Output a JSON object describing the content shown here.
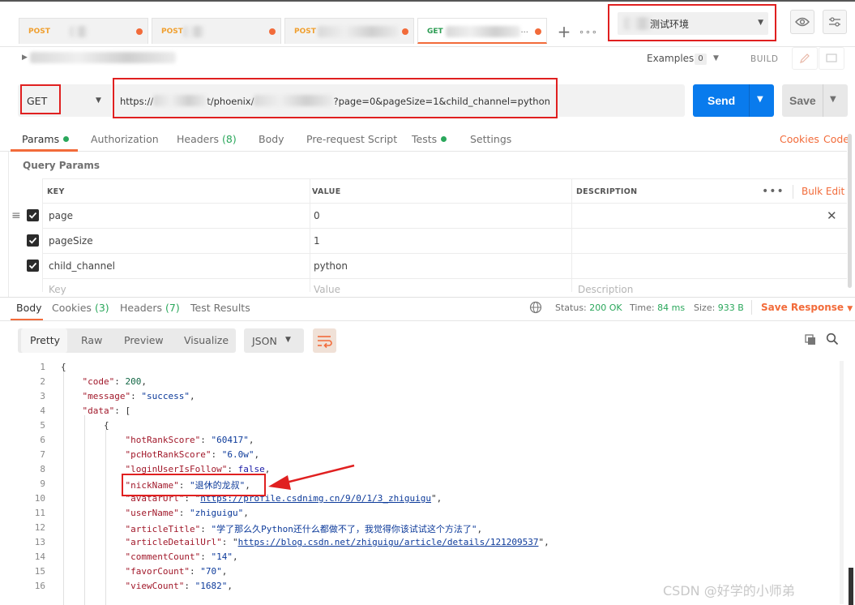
{
  "tabs": [
    {
      "method": "POST",
      "modified": true
    },
    {
      "method": "POST",
      "modified": true
    },
    {
      "method": "POST",
      "modified": true
    },
    {
      "method": "GET",
      "suffix": "...",
      "modified": true,
      "active": true
    }
  ],
  "environment": {
    "name": "测试环境"
  },
  "request": {
    "examples_label": "Examples",
    "examples_count": "0",
    "build_label": "BUILD",
    "method": "GET",
    "url_part1": "https://",
    "url_part2": "t/phoenix/",
    "url_part3": "?page=0&pageSize=1&child_channel=python",
    "send_label": "Send",
    "save_label": "Save"
  },
  "request_tabs": {
    "params": "Params",
    "authorization": "Authorization",
    "headers": "Headers",
    "headers_count": "(8)",
    "body": "Body",
    "prerequest": "Pre-request Script",
    "tests": "Tests",
    "settings": "Settings",
    "cookies": "Cookies",
    "code": "Code"
  },
  "query_params": {
    "title": "Query Params",
    "headers": {
      "key": "KEY",
      "value": "VALUE",
      "description": "DESCRIPTION"
    },
    "bulk_edit": "Bulk Edit",
    "rows": [
      {
        "key": "page",
        "value": "0",
        "checked": true
      },
      {
        "key": "pageSize",
        "value": "1",
        "checked": true
      },
      {
        "key": "child_channel",
        "value": "python",
        "checked": true
      }
    ],
    "placeholder": {
      "key": "Key",
      "value": "Value",
      "description": "Description"
    }
  },
  "response": {
    "tabs": {
      "body": "Body",
      "cookies": "Cookies",
      "cookies_count": "(3)",
      "headers": "Headers",
      "headers_count": "(7)",
      "test_results": "Test Results"
    },
    "status_label": "Status:",
    "status_value": "200 OK",
    "time_label": "Time:",
    "time_value": "84 ms",
    "size_label": "Size:",
    "size_value": "933 B",
    "save_response": "Save Response",
    "views": [
      "Pretty",
      "Raw",
      "Preview",
      "Visualize"
    ],
    "active_view": "Pretty",
    "format": "JSON"
  },
  "code_lines": [
    {
      "n": "1",
      "indent": 0,
      "parts": [
        [
          "p",
          "{"
        ]
      ]
    },
    {
      "n": "2",
      "indent": 1,
      "parts": [
        [
          "k",
          "\"code\""
        ],
        [
          "p",
          ": "
        ],
        [
          "n",
          "200"
        ],
        [
          "p",
          ","
        ]
      ]
    },
    {
      "n": "3",
      "indent": 1,
      "parts": [
        [
          "k",
          "\"message\""
        ],
        [
          "p",
          ": "
        ],
        [
          "s",
          "\"success\""
        ],
        [
          "p",
          ","
        ]
      ]
    },
    {
      "n": "4",
      "indent": 1,
      "parts": [
        [
          "k",
          "\"data\""
        ],
        [
          "p",
          ": ["
        ]
      ]
    },
    {
      "n": "5",
      "indent": 2,
      "parts": [
        [
          "p",
          "{"
        ]
      ]
    },
    {
      "n": "6",
      "indent": 3,
      "parts": [
        [
          "k",
          "\"hotRankScore\""
        ],
        [
          "p",
          ": "
        ],
        [
          "s",
          "\"60417\""
        ],
        [
          "p",
          ","
        ]
      ]
    },
    {
      "n": "7",
      "indent": 3,
      "parts": [
        [
          "k",
          "\"pcHotRankScore\""
        ],
        [
          "p",
          ": "
        ],
        [
          "s",
          "\"6.0w\""
        ],
        [
          "p",
          ","
        ]
      ]
    },
    {
      "n": "8",
      "indent": 3,
      "parts": [
        [
          "k",
          "\"loginUserIsFollow\""
        ],
        [
          "p",
          ": "
        ],
        [
          "b",
          "false"
        ],
        [
          "p",
          ","
        ]
      ]
    },
    {
      "n": "9",
      "indent": 3,
      "parts": [
        [
          "k",
          "\"nickName\""
        ],
        [
          "p",
          ": "
        ],
        [
          "s",
          "\"退休的龙叔\""
        ],
        [
          "p",
          ","
        ]
      ]
    },
    {
      "n": "10",
      "indent": 3,
      "parts": [
        [
          "k",
          "\"avatarUrl\""
        ],
        [
          "p",
          ": \""
        ],
        [
          "u",
          "https://profile.csdnimg.cn/9/0/1/3_zhiguigu"
        ],
        [
          "p",
          "\","
        ]
      ]
    },
    {
      "n": "11",
      "indent": 3,
      "parts": [
        [
          "k",
          "\"userName\""
        ],
        [
          "p",
          ": "
        ],
        [
          "s",
          "\"zhiguigu\""
        ],
        [
          "p",
          ","
        ]
      ]
    },
    {
      "n": "12",
      "indent": 3,
      "parts": [
        [
          "k",
          "\"articleTitle\""
        ],
        [
          "p",
          ": "
        ],
        [
          "s",
          "\"学了那么久Python还什么都做不了，我觉得你该试试这个方法了\""
        ],
        [
          "p",
          ","
        ]
      ]
    },
    {
      "n": "13",
      "indent": 3,
      "parts": [
        [
          "k",
          "\"articleDetailUrl\""
        ],
        [
          "p",
          ": \""
        ],
        [
          "u",
          "https://blog.csdn.net/zhiguigu/article/details/121209537"
        ],
        [
          "p",
          "\","
        ]
      ]
    },
    {
      "n": "14",
      "indent": 3,
      "parts": [
        [
          "k",
          "\"commentCount\""
        ],
        [
          "p",
          ": "
        ],
        [
          "s",
          "\"14\""
        ],
        [
          "p",
          ","
        ]
      ]
    },
    {
      "n": "15",
      "indent": 3,
      "parts": [
        [
          "k",
          "\"favorCount\""
        ],
        [
          "p",
          ": "
        ],
        [
          "s",
          "\"70\""
        ],
        [
          "p",
          ","
        ]
      ]
    },
    {
      "n": "16",
      "indent": 3,
      "parts": [
        [
          "k",
          "\"viewCount\""
        ],
        [
          "p",
          ": "
        ],
        [
          "s",
          "\"1682\""
        ],
        [
          "p",
          ","
        ]
      ]
    }
  ],
  "watermark": "CSDN @好学的小师弟",
  "colors": {
    "accent": "#f26b3a",
    "send": "#097bed",
    "status_ok": "#2aa75b",
    "highlight": "#e02020"
  }
}
